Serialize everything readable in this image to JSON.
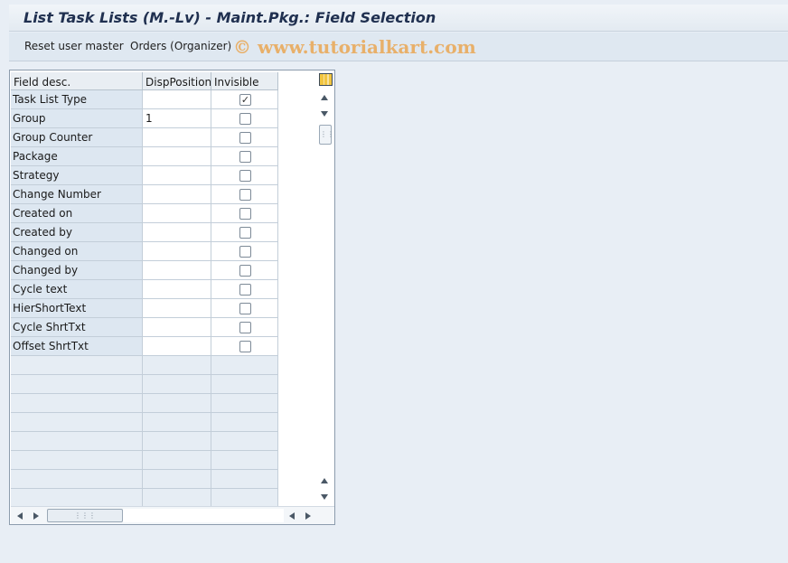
{
  "window": {
    "title": "List Task Lists (M.-Lv) - Maint.Pkg.: Field Selection"
  },
  "toolbar": {
    "reset_label": "Reset user master",
    "orders_label": "Orders (Organizer)",
    "watermark": "© www.tutorialkart.com"
  },
  "grid": {
    "columns": [
      "Field desc.",
      "DispPosition",
      "Invisible"
    ],
    "rows": [
      {
        "desc": "Task List Type",
        "pos": "",
        "invisible": true
      },
      {
        "desc": "Group",
        "pos": "1",
        "invisible": false
      },
      {
        "desc": "Group Counter",
        "pos": "",
        "invisible": false
      },
      {
        "desc": "Package",
        "pos": "",
        "invisible": false
      },
      {
        "desc": "Strategy",
        "pos": "",
        "invisible": false
      },
      {
        "desc": "Change Number",
        "pos": "",
        "invisible": false
      },
      {
        "desc": "Created on",
        "pos": "",
        "invisible": false
      },
      {
        "desc": "Created by",
        "pos": "",
        "invisible": false
      },
      {
        "desc": "Changed on",
        "pos": "",
        "invisible": false
      },
      {
        "desc": "Changed by",
        "pos": "",
        "invisible": false
      },
      {
        "desc": "Cycle text",
        "pos": "",
        "invisible": false
      },
      {
        "desc": "HierShortText",
        "pos": "",
        "invisible": false
      },
      {
        "desc": "Cycle ShrtTxt",
        "pos": "",
        "invisible": false
      },
      {
        "desc": "Offset ShrtTxt",
        "pos": "",
        "invisible": false
      }
    ],
    "empty_rows": 8,
    "checked_glyph": "✓"
  },
  "icons": {
    "settings": "table-settings-icon",
    "scroll_up": "chevron-up-icon",
    "scroll_down": "chevron-down-icon",
    "scroll_left": "chevron-left-icon",
    "scroll_right": "chevron-right-icon"
  },
  "colors": {
    "background": "#e8eef5",
    "title_text": "#203050",
    "field_cell": "#dde7f1",
    "watermark": "#e8b06a"
  }
}
